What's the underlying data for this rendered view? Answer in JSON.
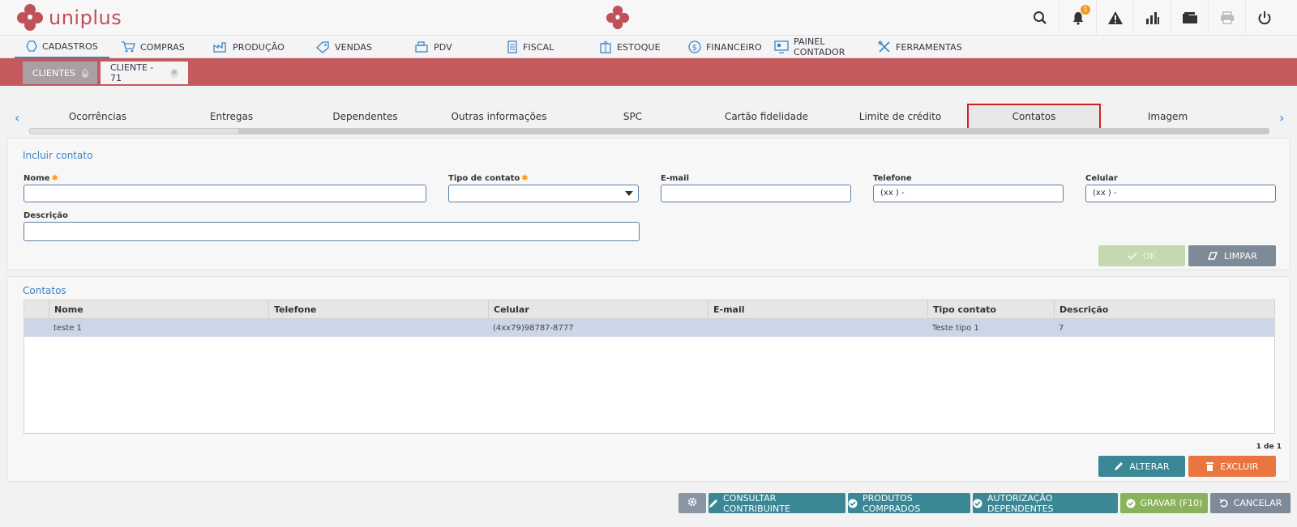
{
  "app": {
    "name": "uniplus"
  },
  "topbar": {
    "notification_count": "1",
    "icons": [
      "search-icon",
      "bell-icon",
      "alert-icon",
      "chart-icon",
      "folder-icon",
      "printer-icon",
      "power-icon"
    ]
  },
  "nav": {
    "items": [
      {
        "label": "CADASTROS",
        "icon": "hexagon-icon"
      },
      {
        "label": "COMPRAS",
        "icon": "cart-icon"
      },
      {
        "label": "PRODUÇÃO",
        "icon": "factory-icon"
      },
      {
        "label": "VENDAS",
        "icon": "tag-icon"
      },
      {
        "label": "PDV",
        "icon": "register-icon"
      },
      {
        "label": "FISCAL",
        "icon": "document-icon"
      },
      {
        "label": "ESTOQUE",
        "icon": "box-icon"
      },
      {
        "label": "FINANCEIRO",
        "icon": "dollar-icon"
      },
      {
        "label": "PAINEL CONTADOR",
        "icon": "panel-icon"
      },
      {
        "label": "FERRAMENTAS",
        "icon": "tools-icon"
      }
    ]
  },
  "window_tabs": [
    {
      "label": "CLIENTES"
    },
    {
      "label": "CLIENTE - 71"
    }
  ],
  "subtabs": [
    "Ocorrências",
    "Entregas",
    "Dependentes",
    "Outras informações",
    "SPC",
    "Cartão fidelidade",
    "Limite de crédito",
    "Contatos",
    "Imagem"
  ],
  "form": {
    "title": "Incluir contato",
    "nome_label": "Nome",
    "tipo_label": "Tipo de contato",
    "email_label": "E-mail",
    "telefone_label": "Telefone",
    "telefone_value": "(xx )   -",
    "celular_label": "Celular",
    "celular_value": "(xx )   -",
    "descricao_label": "Descrição",
    "ok_label": "OK",
    "limpar_label": "LIMPAR"
  },
  "contacts": {
    "title": "Contatos",
    "columns": [
      "Nome",
      "Telefone",
      "Celular",
      "E-mail",
      "Tipo contato",
      "Descrição"
    ],
    "rows": [
      [
        "teste 1",
        "",
        "(4xx79)98787-8777",
        "",
        "Teste tipo 1",
        "7"
      ]
    ],
    "pager": "1 de 1",
    "alterar_label": "ALTERAR",
    "excluir_label": "EXCLUIR"
  },
  "footer": {
    "consultar_label": "CONSULTAR CONTRIBUINTE",
    "produtos_label": "PRODUTOS COMPRADOS",
    "autorizacao_label": "AUTORIZAÇÃO DEPENDENTES",
    "gravar_label": "GRAVAR (F10)",
    "cancelar_label": "CANCELAR"
  },
  "colors": {
    "brand_red": "#c45a5e",
    "accent_blue": "#3c84c8",
    "teal": "#3a8796",
    "orange": "#e9763f",
    "green": "#8ab15b"
  }
}
